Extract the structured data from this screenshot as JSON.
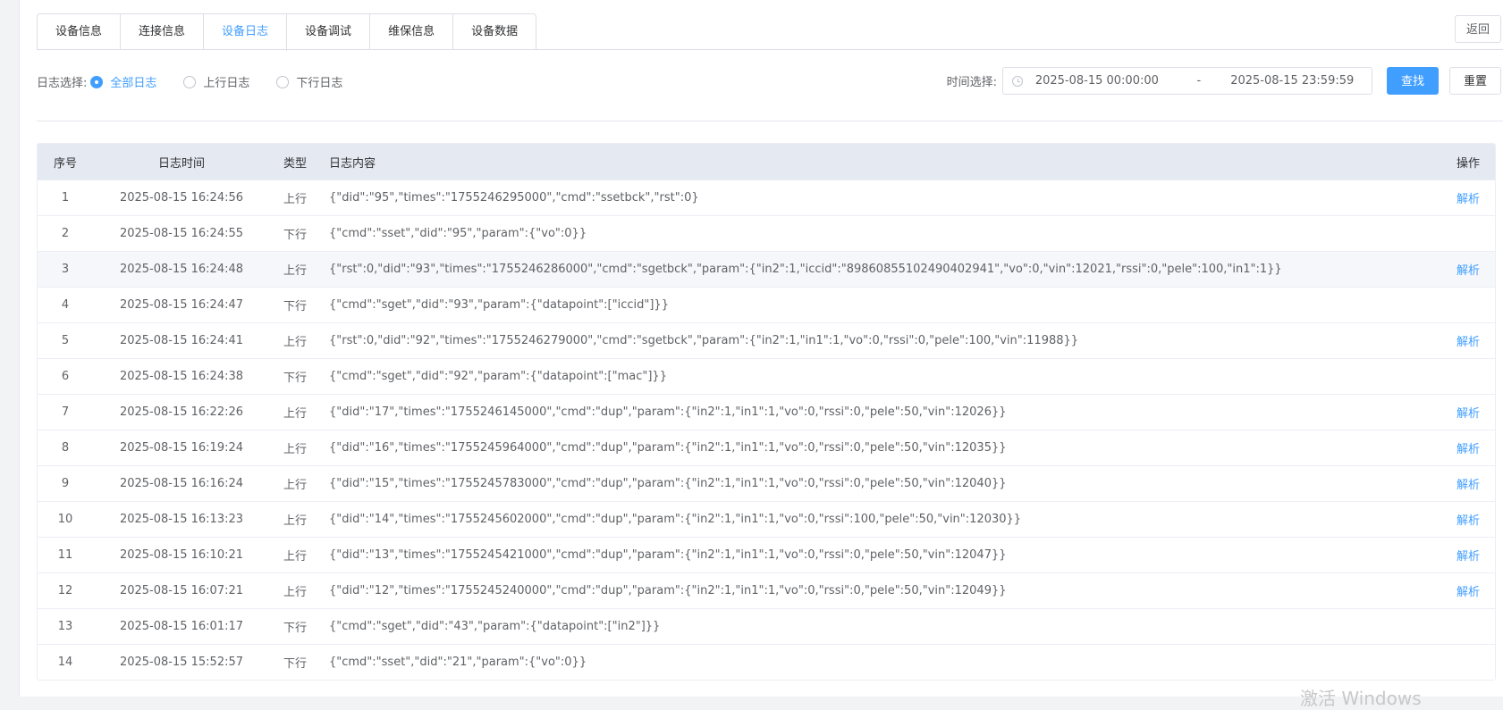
{
  "tabs": [
    {
      "label": "设备信息",
      "active": false
    },
    {
      "label": "连接信息",
      "active": false
    },
    {
      "label": "设备日志",
      "active": true
    },
    {
      "label": "设备调试",
      "active": false
    },
    {
      "label": "维保信息",
      "active": false
    },
    {
      "label": "设备数据",
      "active": false
    }
  ],
  "back_label": "返回",
  "filter": {
    "label": "日志选择:",
    "options": [
      "全部日志",
      "上行日志",
      "下行日志"
    ],
    "selected": "全部日志"
  },
  "time": {
    "label": "时间选择:",
    "start": "2025-08-15 00:00:00",
    "separator": "-",
    "end": "2025-08-15 23:59:59"
  },
  "buttons": {
    "search": "查找",
    "reset": "重置"
  },
  "table": {
    "headers": [
      "序号",
      "日志时间",
      "类型",
      "日志内容",
      "操作"
    ],
    "rows": [
      {
        "idx": "1",
        "time": "2025-08-15 16:24:56",
        "type": "上行",
        "content": "{\"did\":\"95\",\"times\":\"1755246295000\",\"cmd\":\"ssetbck\",\"rst\":0}",
        "op": "解析"
      },
      {
        "idx": "2",
        "time": "2025-08-15 16:24:55",
        "type": "下行",
        "content": "{\"cmd\":\"sset\",\"did\":\"95\",\"param\":{\"vo\":0}}",
        "op": ""
      },
      {
        "idx": "3",
        "time": "2025-08-15 16:24:48",
        "type": "上行",
        "content": "{\"rst\":0,\"did\":\"93\",\"times\":\"1755246286000\",\"cmd\":\"sgetbck\",\"param\":{\"in2\":1,\"iccid\":\"89860855102490402941\",\"vo\":0,\"vin\":12021,\"rssi\":0,\"pele\":100,\"in1\":1}}",
        "op": "解析"
      },
      {
        "idx": "4",
        "time": "2025-08-15 16:24:47",
        "type": "下行",
        "content": "{\"cmd\":\"sget\",\"did\":\"93\",\"param\":{\"datapoint\":[\"iccid\"]}}",
        "op": ""
      },
      {
        "idx": "5",
        "time": "2025-08-15 16:24:41",
        "type": "上行",
        "content": "{\"rst\":0,\"did\":\"92\",\"times\":\"1755246279000\",\"cmd\":\"sgetbck\",\"param\":{\"in2\":1,\"in1\":1,\"vo\":0,\"rssi\":0,\"pele\":100,\"vin\":11988}}",
        "op": "解析"
      },
      {
        "idx": "6",
        "time": "2025-08-15 16:24:38",
        "type": "下行",
        "content": "{\"cmd\":\"sget\",\"did\":\"92\",\"param\":{\"datapoint\":[\"mac\"]}}",
        "op": ""
      },
      {
        "idx": "7",
        "time": "2025-08-15 16:22:26",
        "type": "上行",
        "content": "{\"did\":\"17\",\"times\":\"1755246145000\",\"cmd\":\"dup\",\"param\":{\"in2\":1,\"in1\":1,\"vo\":0,\"rssi\":0,\"pele\":50,\"vin\":12026}}",
        "op": "解析"
      },
      {
        "idx": "8",
        "time": "2025-08-15 16:19:24",
        "type": "上行",
        "content": "{\"did\":\"16\",\"times\":\"1755245964000\",\"cmd\":\"dup\",\"param\":{\"in2\":1,\"in1\":1,\"vo\":0,\"rssi\":0,\"pele\":50,\"vin\":12035}}",
        "op": "解析"
      },
      {
        "idx": "9",
        "time": "2025-08-15 16:16:24",
        "type": "上行",
        "content": "{\"did\":\"15\",\"times\":\"1755245783000\",\"cmd\":\"dup\",\"param\":{\"in2\":1,\"in1\":1,\"vo\":0,\"rssi\":0,\"pele\":50,\"vin\":12040}}",
        "op": "解析"
      },
      {
        "idx": "10",
        "time": "2025-08-15 16:13:23",
        "type": "上行",
        "content": "{\"did\":\"14\",\"times\":\"1755245602000\",\"cmd\":\"dup\",\"param\":{\"in2\":1,\"in1\":1,\"vo\":0,\"rssi\":100,\"pele\":50,\"vin\":12030}}",
        "op": "解析"
      },
      {
        "idx": "11",
        "time": "2025-08-15 16:10:21",
        "type": "上行",
        "content": "{\"did\":\"13\",\"times\":\"1755245421000\",\"cmd\":\"dup\",\"param\":{\"in2\":1,\"in1\":1,\"vo\":0,\"rssi\":0,\"pele\":50,\"vin\":12047}}",
        "op": "解析"
      },
      {
        "idx": "12",
        "time": "2025-08-15 16:07:21",
        "type": "上行",
        "content": "{\"did\":\"12\",\"times\":\"1755245240000\",\"cmd\":\"dup\",\"param\":{\"in2\":1,\"in1\":1,\"vo\":0,\"rssi\":0,\"pele\":50,\"vin\":12049}}",
        "op": "解析"
      },
      {
        "idx": "13",
        "time": "2025-08-15 16:01:17",
        "type": "下行",
        "content": "{\"cmd\":\"sget\",\"did\":\"43\",\"param\":{\"datapoint\":[\"in2\"]}}",
        "op": ""
      },
      {
        "idx": "14",
        "time": "2025-08-15 15:52:57",
        "type": "下行",
        "content": "{\"cmd\":\"sset\",\"did\":\"21\",\"param\":{\"vo\":0}}",
        "op": ""
      }
    ]
  },
  "watermark": "激活 Windows",
  "colors": {
    "primary": "#409eff",
    "header_bg": "#e4e9f2",
    "stripe_bg": "#f5f7fa"
  }
}
